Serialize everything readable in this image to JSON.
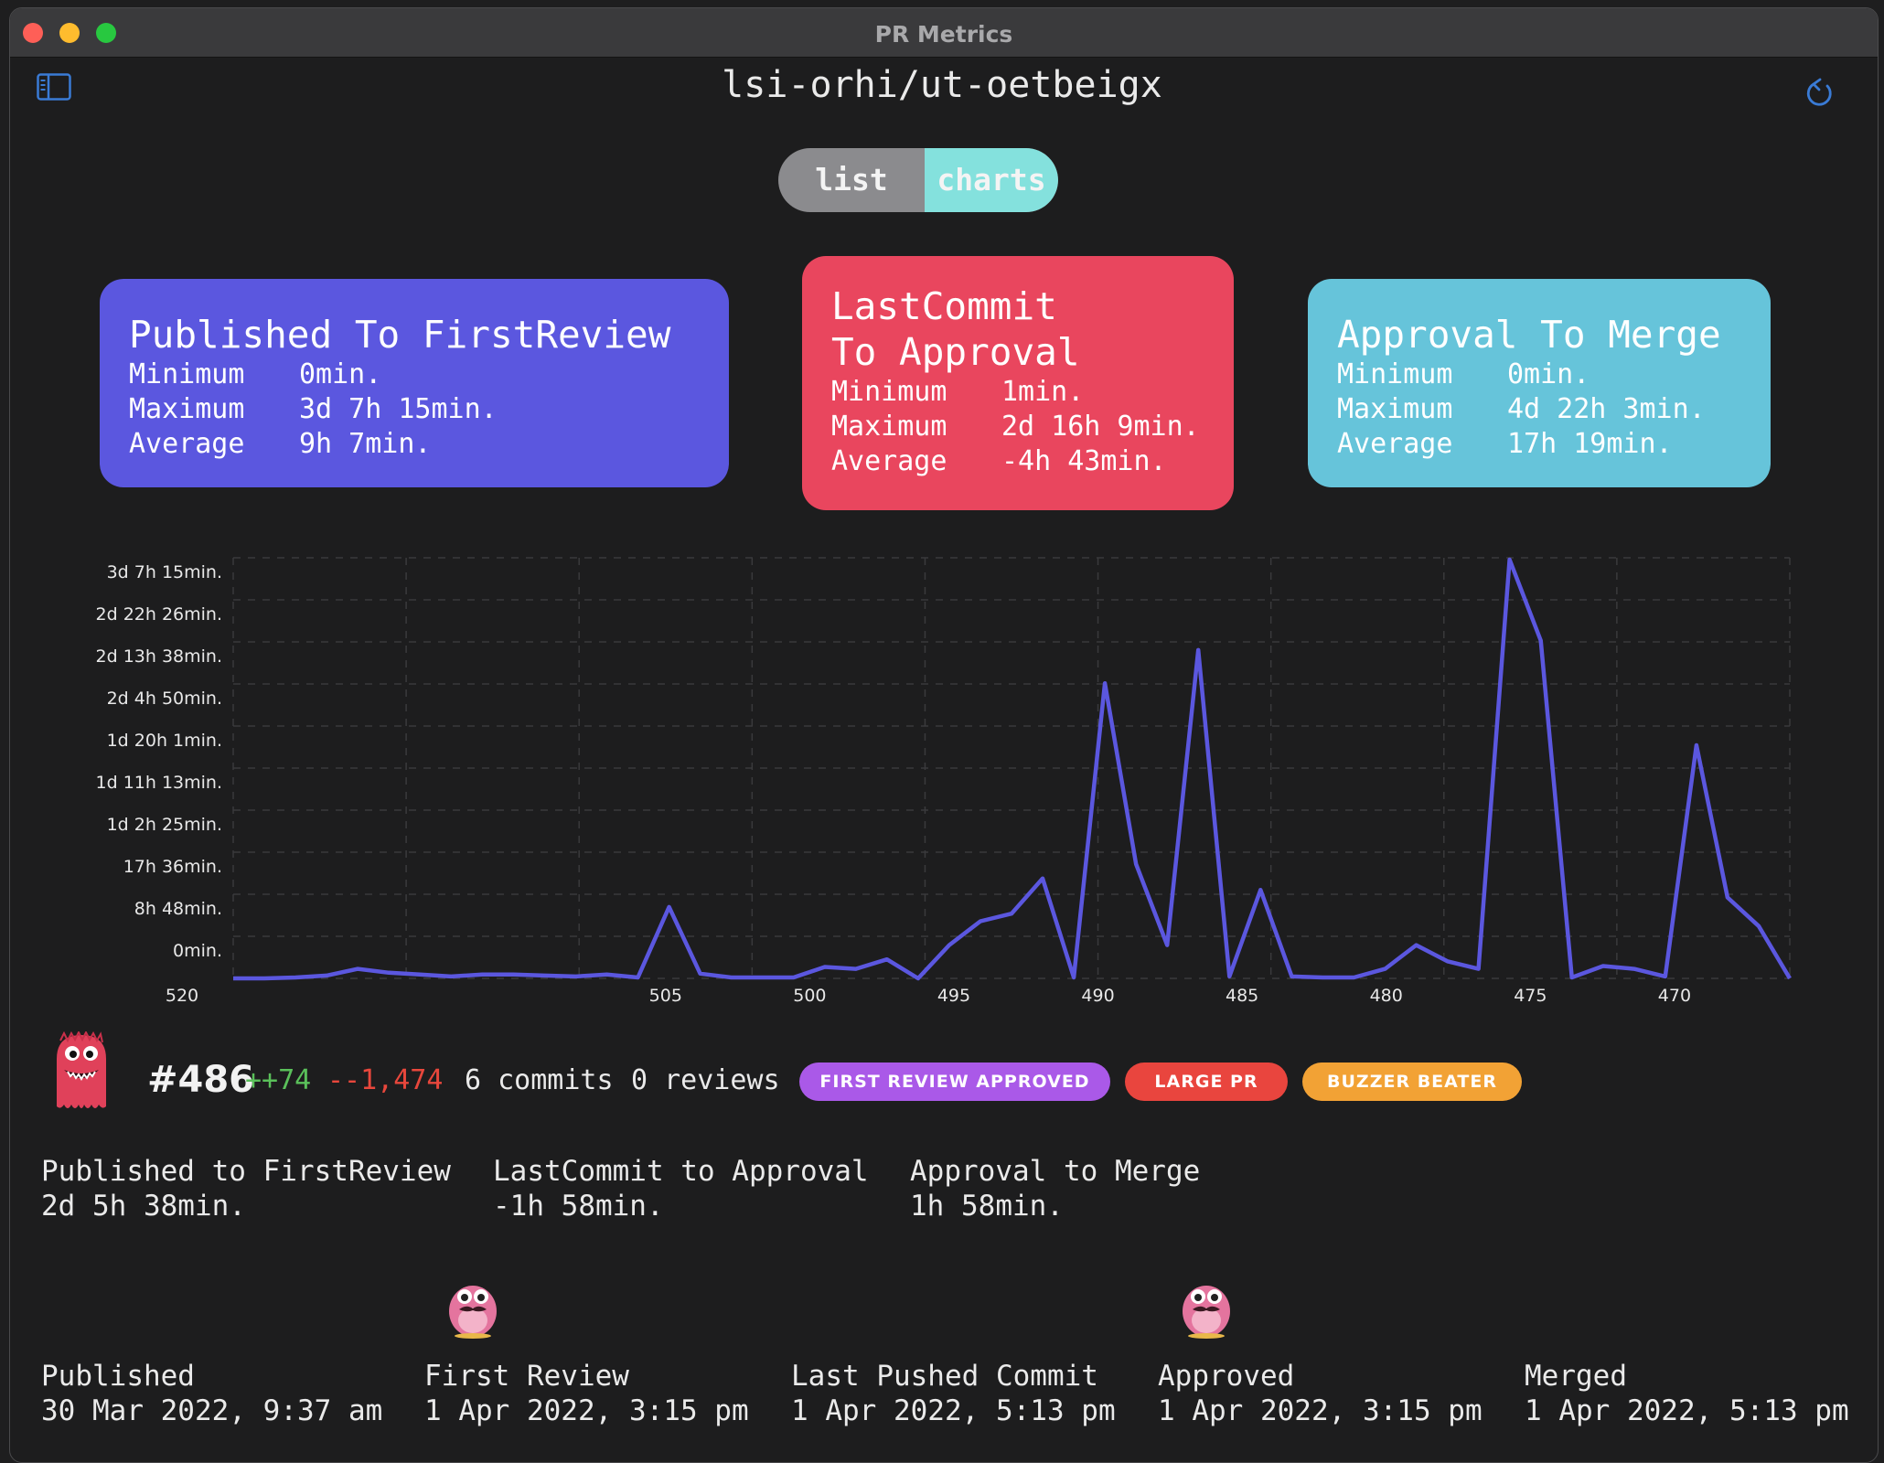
{
  "window": {
    "title": "PR Metrics"
  },
  "header": {
    "repo": "lsi-orhi/ut-oetbeigx"
  },
  "view_toggle": {
    "options": [
      "list",
      "charts"
    ],
    "selected": "charts"
  },
  "cards": [
    {
      "title": "Published To FirstReview",
      "color": "#5b57df",
      "minimum_label": "Minimum",
      "minimum": "0min.",
      "maximum_label": "Maximum",
      "maximum": "3d 7h 15min.",
      "average_label": "Average",
      "average": "9h 7min."
    },
    {
      "title": "LastCommit\nTo Approval",
      "color": "#e9465e",
      "minimum_label": "Minimum",
      "minimum": "1min.",
      "maximum_label": "Maximum",
      "maximum": "2d 16h 9min.",
      "average_label": "Average",
      "average": "-4h 43min."
    },
    {
      "title": "Approval To Merge",
      "color": "#66c4da",
      "minimum_label": "Minimum",
      "minimum": "0min.",
      "maximum_label": "Maximum",
      "maximum": "4d 22h 3min.",
      "average_label": "Average",
      "average": "17h 19min."
    }
  ],
  "chart_data": {
    "type": "line",
    "series": [
      {
        "color": "#5b57df",
        "values": [
          0,
          0,
          0.01,
          0.03,
          0.1,
          0.06,
          0.04,
          0.02,
          0.04,
          0.04,
          0.03,
          0.02,
          0.04,
          0.01,
          0.75,
          0.05,
          0.01,
          0.01,
          0.01,
          0.12,
          0.1,
          0.2,
          0,
          0.35,
          0.6,
          0.68,
          1.05,
          0.01,
          3.1,
          1.2,
          0.35,
          3.45,
          0.02,
          0.93,
          0.02,
          0.01,
          0.01,
          0.1,
          0.35,
          0.18,
          0.1,
          4.4,
          3.55,
          0.01,
          0.13,
          0.1,
          0.02,
          2.45,
          0.85,
          0.55,
          0
        ]
      }
    ],
    "x_labels": [
      "520",
      "505",
      "500",
      "495",
      "490",
      "485",
      "480",
      "475",
      "470"
    ],
    "y_labels": [
      "0min.",
      "8h 48min.",
      "17h 36min.",
      "1d 2h 25min.",
      "1d 11h 13min.",
      "1d 20h 1min.",
      "2d 4h 50min.",
      "2d 13h 38min.",
      "2d 22h 26min.",
      "3d 7h 15min."
    ],
    "xlim": [
      520,
      466
    ],
    "grid": true
  },
  "pr": {
    "number": "#486",
    "additions": "++74",
    "deletions": "--1,474",
    "commits": "6 commits",
    "reviews": "0 reviews",
    "badges": [
      "FIRST REVIEW APPROVED",
      "LARGE PR",
      "BUZZER BEATER"
    ],
    "metrics": [
      {
        "label": "Published to FirstReview",
        "value": "2d 5h 38min."
      },
      {
        "label": "LastCommit to Approval",
        "value": "-1h 58min."
      },
      {
        "label": "Approval to Merge",
        "value": "1h 58min."
      }
    ],
    "timeline": [
      {
        "label": "Published",
        "value": "30 Mar 2022, 9:37 am"
      },
      {
        "label": "First Review",
        "value": "1 Apr 2022, 3:15 pm"
      },
      {
        "label": "Last Pushed Commit",
        "value": "1 Apr 2022, 5:13 pm"
      },
      {
        "label": "Approved",
        "value": "1 Apr 2022, 3:15 pm"
      },
      {
        "label": "Merged",
        "value": "1 Apr 2022, 5:13 pm"
      }
    ]
  },
  "icons": {
    "sidebar": "sidebar-toggle-icon",
    "refresh": "refresh-icon",
    "author": "monster-avatar-icon",
    "reviewer": "reviewer-avatar-icon"
  }
}
